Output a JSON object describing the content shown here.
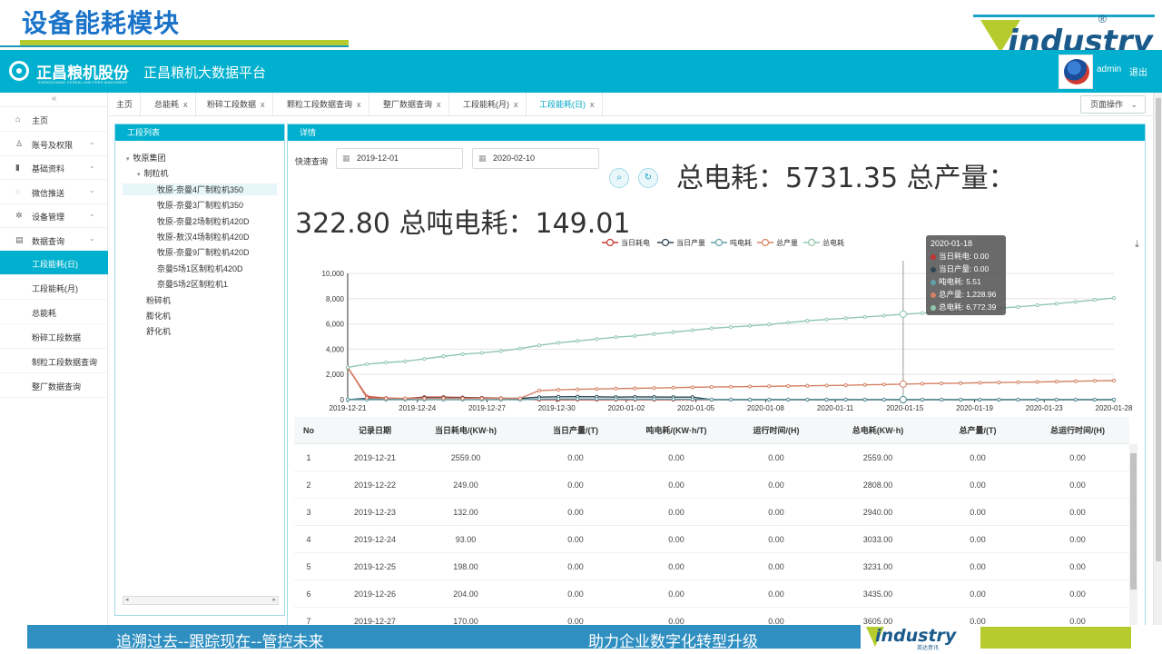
{
  "slide": {
    "title": "设备能耗模块",
    "logo_text": "industry",
    "logo_reg": "®"
  },
  "topbar": {
    "brand_name": "正昌粮机股份",
    "brand_sub": "ZHENGCHANG CEREAL AND FEED MACHINERY",
    "platform_name": "正昌粮机大数据平台",
    "user_name": "admin",
    "logout_label": "退出"
  },
  "sidebar": {
    "collapse": "«",
    "menu": [
      {
        "label": "主页",
        "icon": "home-icon",
        "glyph": "⌂",
        "has_chevron": false
      },
      {
        "label": "账号及权限",
        "icon": "user-icon",
        "glyph": "♙",
        "has_chevron": true
      },
      {
        "label": "基础资料",
        "icon": "bar-chart-icon",
        "glyph": "▮",
        "has_chevron": true
      },
      {
        "label": "微信推送",
        "icon": "chat-icon",
        "glyph": "◌",
        "has_chevron": true
      },
      {
        "label": "设备管理",
        "icon": "gear-icon",
        "glyph": "✲",
        "has_chevron": true
      },
      {
        "label": "数据查询",
        "icon": "table-icon",
        "glyph": "▤",
        "has_chevron": true
      }
    ],
    "submenu": [
      {
        "label": "工段能耗(日)",
        "active": true
      },
      {
        "label": "工段能耗(月)",
        "active": false
      },
      {
        "label": "总能耗",
        "active": false
      },
      {
        "label": "粉碎工段数据",
        "active": false
      },
      {
        "label": "制粒工段数据查询",
        "active": false
      },
      {
        "label": "整厂数据查询",
        "active": false
      }
    ]
  },
  "tabs": [
    {
      "label": "主页",
      "closable": false,
      "active": false
    },
    {
      "label": "总能耗",
      "closable": true,
      "active": false
    },
    {
      "label": "粉碎工段数据",
      "closable": true,
      "active": false
    },
    {
      "label": "颗粒工段数据查询",
      "closable": true,
      "active": false
    },
    {
      "label": "整厂数据查询",
      "closable": true,
      "active": false
    },
    {
      "label": "工段能耗(月)",
      "closable": true,
      "active": false
    },
    {
      "label": "工段能耗(日)",
      "closable": true,
      "active": true
    }
  ],
  "tab_close": "x",
  "page_ops_label": "页面操作",
  "tree": {
    "title": "工段列表",
    "nodes": [
      {
        "label": "牧原集团",
        "caret": "▾",
        "selected": false
      },
      {
        "label": "制粒机",
        "caret": "▾",
        "selected": false
      },
      {
        "label": "牧原-奈曼4厂制粒机350",
        "caret": "",
        "selected": true
      },
      {
        "label": "牧原-奈曼3厂制粒机350",
        "caret": "",
        "selected": false
      },
      {
        "label": "牧原-奈曼2场制粒机420D",
        "caret": "",
        "selected": false
      },
      {
        "label": "牧原-敖汉4场制粒机420D",
        "caret": "",
        "selected": false
      },
      {
        "label": "牧原-奈曼9厂制粒机420D",
        "caret": "",
        "selected": false
      },
      {
        "label": "奈曼5场1区制粒机420D",
        "caret": "",
        "selected": false
      },
      {
        "label": "奈曼5场2区制粒机1",
        "caret": "",
        "selected": false
      },
      {
        "label": "粉碎机",
        "caret": "",
        "selected": false
      },
      {
        "label": "膨化机",
        "caret": "",
        "selected": false
      },
      {
        "label": "舒化机",
        "caret": "",
        "selected": false
      }
    ]
  },
  "detail": {
    "title": "详情",
    "quick_query": "快速查询",
    "start_date": "2019-12-01",
    "end_date": "2020-02-10",
    "search_icon_glyph": "⌕",
    "reset_icon_glyph": "↻",
    "summary_line1": "总电耗：5731.35    总产量：",
    "summary_line2": "322.80    总吨电耗：149.01",
    "download_glyph": "⤓"
  },
  "chart_data": {
    "type": "line",
    "legend": [
      "当日耗电",
      "当日产量",
      "吨电耗",
      "总产量",
      "总电耗"
    ],
    "colors": {
      "当日耗电": "#c23531",
      "当日产量": "#2f4554",
      "吨电耗": "#61a0a8",
      "总产量": "#d48265",
      "总电耗": "#91c7ae"
    },
    "y_ticks": [
      "0",
      "2,000",
      "4,000",
      "6,000",
      "8,000",
      "10,000"
    ],
    "ylim": [
      0,
      10000
    ],
    "x_tick_labels": [
      "2019-12-21",
      "2019-12-24",
      "2019-12-27",
      "2019-12-30",
      "2020-01-02",
      "2020-01-05",
      "2020-01-08",
      "2020-01-11",
      "2020-01-15",
      "2020-01-19",
      "2020-01-23",
      "2020-01-28"
    ],
    "n_points": 41,
    "series": [
      {
        "name": "当日耗电",
        "values": [
          2559,
          249,
          132,
          93,
          198,
          204,
          170,
          150,
          120,
          60,
          0,
          0,
          0,
          0,
          0,
          0,
          0,
          0,
          0,
          0,
          0,
          0,
          0,
          0,
          0,
          0,
          0,
          0,
          0,
          0,
          0,
          0,
          0,
          0,
          0,
          0,
          0,
          0,
          0,
          0,
          0
        ]
      },
      {
        "name": "当日产量",
        "values": [
          0,
          100,
          80,
          60,
          150,
          160,
          140,
          120,
          100,
          100,
          200,
          230,
          240,
          230,
          200,
          220,
          210,
          200,
          200,
          0,
          0,
          0,
          0,
          0,
          0,
          0,
          0,
          0,
          0,
          0,
          0,
          0,
          0,
          0,
          0,
          0,
          0,
          0,
          0,
          0,
          0
        ]
      },
      {
        "name": "吨电耗",
        "values": [
          0,
          0,
          0,
          0,
          0,
          0,
          0,
          0,
          0,
          0,
          50,
          60,
          55,
          50,
          45,
          40,
          45,
          40,
          30,
          10,
          5.51,
          5.51,
          5.51,
          5.51,
          5.51,
          5.51,
          5.51,
          5.51,
          5.51,
          5.51,
          5.51,
          5.51,
          5.51,
          5.51,
          5.51,
          5.51,
          5.51,
          5.51,
          5.51,
          5.51,
          5.51
        ]
      },
      {
        "name": "总产量",
        "values": [
          2559,
          150,
          100,
          100,
          100,
          120,
          100,
          100,
          100,
          110,
          720,
          780,
          820,
          850,
          880,
          900,
          920,
          950,
          980,
          1000,
          1020,
          1040,
          1060,
          1080,
          1100,
          1120,
          1140,
          1170,
          1200,
          1228.96,
          1260,
          1290,
          1310,
          1340,
          1360,
          1380,
          1400,
          1430,
          1460,
          1490,
          1510
        ]
      },
      {
        "name": "总电耗",
        "values": [
          2559,
          2808,
          2940,
          3033,
          3231,
          3435,
          3605,
          3700,
          3850,
          4050,
          4300,
          4500,
          4650,
          4800,
          4950,
          5050,
          5200,
          5350,
          5500,
          5650,
          5750,
          5850,
          5950,
          6100,
          6250,
          6350,
          6450,
          6550,
          6650,
          6772.39,
          6850,
          6950,
          7050,
          7150,
          7250,
          7350,
          7480,
          7600,
          7750,
          7900,
          8050
        ]
      }
    ],
    "highlight_index": 29
  },
  "tooltip": {
    "date": "2020-01-18",
    "rows": [
      {
        "text": "当日耗电: 0.00",
        "color": "#c23531"
      },
      {
        "text": "当日产量: 0.00",
        "color": "#2f4554"
      },
      {
        "text": "吨电耗: 5.51",
        "color": "#61a0a8"
      },
      {
        "text": "总产量: 1,228.96",
        "color": "#d48265"
      },
      {
        "text": "总电耗: 6,772.39",
        "color": "#91c7ae"
      }
    ]
  },
  "table": {
    "headers": [
      "No",
      "记录日期",
      "当日耗电/(KW·h)",
      "当日产量/(T)",
      "吨电耗/(KW·h/T)",
      "运行时间/(H)",
      "总电耗(KW·h)",
      "总产量/(T)",
      "总运行时间/(H)"
    ],
    "rows": [
      [
        "1",
        "2019-12-21",
        "2559.00",
        "0.00",
        "0.00",
        "0.00",
        "2559.00",
        "0.00",
        "0.00"
      ],
      [
        "2",
        "2019-12-22",
        "249.00",
        "0.00",
        "0.00",
        "0.00",
        "2808.00",
        "0.00",
        "0.00"
      ],
      [
        "3",
        "2019-12-23",
        "132.00",
        "0.00",
        "0.00",
        "0.00",
        "2940.00",
        "0.00",
        "0.00"
      ],
      [
        "4",
        "2019-12-24",
        "93.00",
        "0.00",
        "0.00",
        "0.00",
        "3033.00",
        "0.00",
        "0.00"
      ],
      [
        "5",
        "2019-12-25",
        "198.00",
        "0.00",
        "0.00",
        "0.00",
        "3231.00",
        "0.00",
        "0.00"
      ],
      [
        "6",
        "2019-12-26",
        "204.00",
        "0.00",
        "0.00",
        "0.00",
        "3435.00",
        "0.00",
        "0.00"
      ],
      [
        "7",
        "2019-12-27",
        "170.00",
        "0.00",
        "0.00",
        "0.00",
        "3605.00",
        "0.00",
        "0.00"
      ]
    ]
  },
  "footer": {
    "text_left": "追溯过去--跟踪现在--管控未来",
    "text_right": "助力企业数字化转型升级",
    "logo_text": "industry",
    "logo_sub": "英达意讯"
  }
}
